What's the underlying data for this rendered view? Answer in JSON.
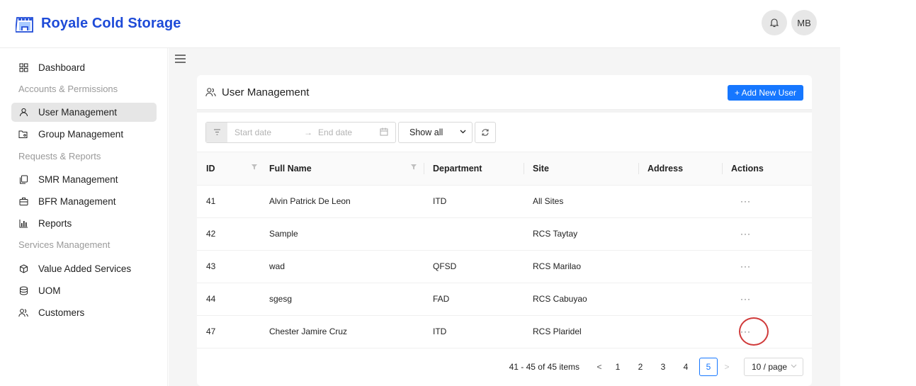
{
  "app": {
    "title": "Royale Cold Storage",
    "brand_color": "#1e4bd8",
    "user_initials": "MB"
  },
  "sidebar": {
    "items": [
      {
        "label": "Dashboard",
        "icon": "grid-icon"
      },
      {
        "label": "User Management",
        "icon": "user-icon",
        "active": true
      },
      {
        "label": "Group Management",
        "icon": "group-folder-icon"
      },
      {
        "label": "SMR Management",
        "icon": "copy-icon"
      },
      {
        "label": "BFR Management",
        "icon": "briefcase-icon"
      },
      {
        "label": "Reports",
        "icon": "bar-chart-icon"
      },
      {
        "label": "Value Added Services",
        "icon": "box-icon"
      },
      {
        "label": "UOM",
        "icon": "database-icon"
      },
      {
        "label": "Customers",
        "icon": "users-icon"
      }
    ],
    "groups": [
      "Accounts & Permissions",
      "Requests & Reports",
      "Services Management"
    ]
  },
  "page": {
    "title": "User Management",
    "add_button": "+ Add New User",
    "accent": "#1677ff"
  },
  "filters": {
    "start_placeholder": "Start date",
    "end_placeholder": "End date",
    "arrow": "→",
    "select_value": "Show all"
  },
  "table": {
    "columns": [
      "ID",
      "Full Name",
      "Department",
      "Site",
      "Address",
      "Actions"
    ],
    "rows": [
      {
        "id": "41",
        "name": "Alvin Patrick De Leon",
        "department": "ITD",
        "site": "All Sites",
        "address": "",
        "actions": "···"
      },
      {
        "id": "42",
        "name": "Sample",
        "department": "",
        "site": "RCS Taytay",
        "address": "",
        "actions": "···"
      },
      {
        "id": "43",
        "name": "wad",
        "department": "QFSD",
        "site": "RCS Marilao",
        "address": "",
        "actions": "···"
      },
      {
        "id": "44",
        "name": "sgesg",
        "department": "FAD",
        "site": "RCS Cabuyao",
        "address": "",
        "actions": "···"
      },
      {
        "id": "47",
        "name": "Chester Jamire Cruz",
        "department": "ITD",
        "site": "RCS Plaridel",
        "address": "",
        "actions": "···"
      }
    ]
  },
  "pagination": {
    "total_text": "41 - 45 of 45 items",
    "prev": "<",
    "next": ">",
    "pages": [
      "1",
      "2",
      "3",
      "4",
      "5"
    ],
    "current": "5",
    "page_size": "10 / page"
  }
}
